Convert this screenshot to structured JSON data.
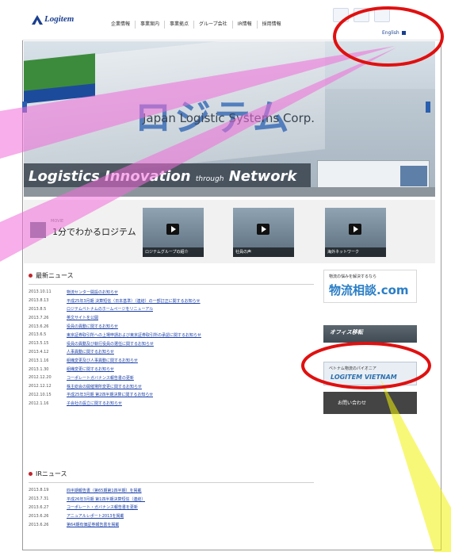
{
  "header": {
    "logo_text": "Logitem",
    "nav": [
      "企業情報",
      "事業案内",
      "事業拠点",
      "グループ会社",
      "IR情報",
      "採用情報"
    ],
    "utility_icons": [
      "sitemap-icon",
      "contact-icon",
      "search-icon"
    ],
    "english_link": "English"
  },
  "hero": {
    "sign_text": "ロジテム",
    "corp_text": "Japan Logistic Systems Corp.",
    "tagline_main": "Logistics Innovation",
    "tagline_small": "through",
    "tagline_end": "Network"
  },
  "videos": {
    "small_label": "MOVIE",
    "label": "1分でわかるロジテム",
    "items": [
      {
        "caption": "ロジテムグループの紹介"
      },
      {
        "caption": "社員の声"
      },
      {
        "caption": "海外ネットワーク"
      }
    ]
  },
  "news": {
    "title": "最新ニュース",
    "items": [
      {
        "date": "2013.10.11",
        "text": "物流センター開設のお知らせ"
      },
      {
        "date": "2013.8.13",
        "text": "平成25年3月期 決算短信（日本基準）（連結）の一部訂正に関するお知らせ"
      },
      {
        "date": "2013.8.5",
        "text": "ロジテムベトナムのホームページをリニューアル"
      },
      {
        "date": "2013.7.26",
        "text": "英文サイトを公開"
      },
      {
        "date": "2013.6.26",
        "text": "役員の異動に関するお知らせ"
      },
      {
        "date": "2013.6.5",
        "text": "東京証券取引所への上場申請および東京証券取引所の承認に関するお知らせ"
      },
      {
        "date": "2013.5.15",
        "text": "役員の異動及び執行役員の選任に関するお知らせ"
      },
      {
        "date": "2013.4.12",
        "text": "人事異動に関するお知らせ"
      },
      {
        "date": "2013.1.16",
        "text": "組織変更及び人事異動に関するお知らせ"
      },
      {
        "date": "2013.1.30",
        "text": "組織変更に関するお知らせ"
      },
      {
        "date": "2012.12.20",
        "text": "コーポレートガバナンス報告書の更新"
      },
      {
        "date": "2012.12.12",
        "text": "株主総会の開催場所変更に関するお知らせ"
      },
      {
        "date": "2012.10.15",
        "text": "平成25年3月期 第2四半期決算に関するお知らせ"
      },
      {
        "date": "2012.1.16",
        "text": "子会社の設立に関するお知らせ"
      }
    ]
  },
  "ir_news": {
    "title": "IRニュース",
    "items": [
      {
        "date": "2013.8.19",
        "text": "四半期報告書（第65期第1四半期）を掲載"
      },
      {
        "date": "2013.7.31",
        "text": "平成26年3月期 第1四半期決算短信（連結）"
      },
      {
        "date": "2013.6.27",
        "text": "コーポレート・ガバナンス報告書を更新"
      },
      {
        "date": "2013.6.26",
        "text": "アニュアルレポート2013を掲載"
      },
      {
        "date": "2013.6.26",
        "text": "第64期有価証券報告書を掲載"
      }
    ]
  },
  "sidebar": {
    "consult_small": "物流の悩みを解決するなら",
    "consult_big": "物流相談.com",
    "office_banner": "オフィス移転",
    "vietnam_small": "ベトナム物流のパイオニア",
    "vietnam_big": "LOGITEM VIETNAM",
    "contact": "お問い合わせ"
  },
  "annotations": {
    "red_circle_color": "#e01010",
    "pink_color": "#f06bd8",
    "yellow_color": "#f2f20a"
  }
}
